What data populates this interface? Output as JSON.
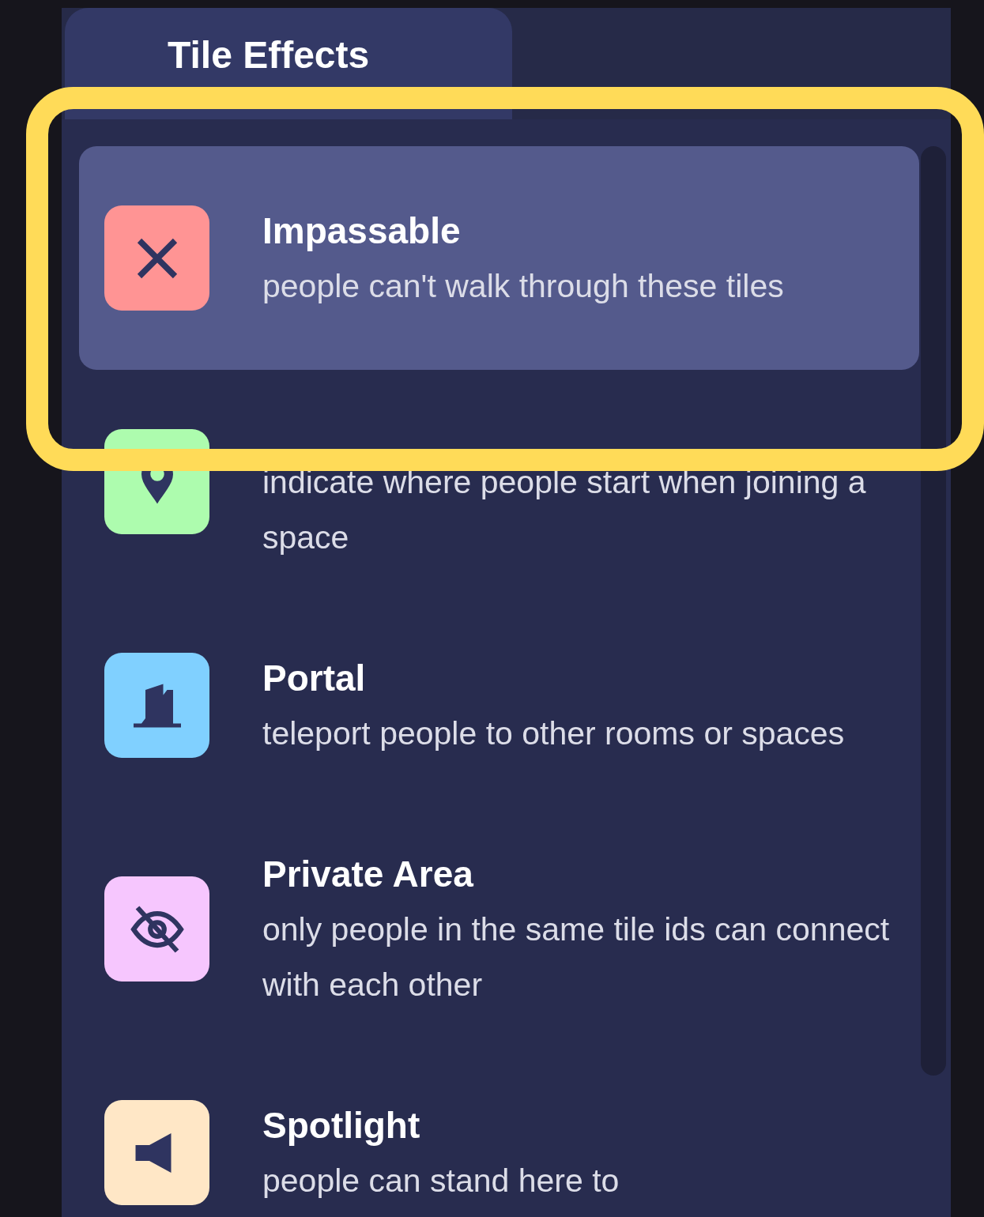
{
  "tabs": [
    {
      "label": "Tile Effects",
      "selected": true
    }
  ],
  "effects": [
    {
      "kind": "impassable",
      "title": "Impassable",
      "description": "people can't walk through these tiles",
      "color": "#ff9494",
      "selected": true
    },
    {
      "kind": "spawn",
      "description": "indicate where people start when joining a space",
      "color": "#adfcae",
      "selected": false
    },
    {
      "kind": "portal",
      "title": "Portal",
      "description": "teleport people to other rooms or spaces",
      "color": "#80d0ff",
      "selected": false
    },
    {
      "kind": "private",
      "title": "Private Area",
      "description": "only people in the same tile ids can connect with each other",
      "color": "#f6c6fe",
      "selected": false
    },
    {
      "kind": "spotlight",
      "title": "Spotlight",
      "description": "people can stand here to",
      "color": "#ffe7c6",
      "selected": false
    }
  ]
}
